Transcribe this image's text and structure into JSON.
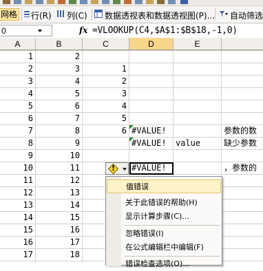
{
  "toolbar": {
    "item1_label": "网格",
    "item2_label": "行(R)",
    "item3_label": "列(C)",
    "item4_label": "数据透视表和数据透视图(P)...",
    "item5_label": "自动筛选"
  },
  "formula_bar": {
    "name_box": "0",
    "fx_label": "fx",
    "formula": "=VLOOKUP(C4,$A$1:$B$18,-1,0)"
  },
  "columns": [
    "A",
    "B",
    "C",
    "D",
    "E"
  ],
  "rows": [
    {
      "a": "1",
      "b": "2"
    },
    {
      "a": "2",
      "b": "3",
      "c": "1"
    },
    {
      "a": "3",
      "b": "4",
      "c": "2"
    },
    {
      "a": "4",
      "b": "5",
      "c": "3"
    },
    {
      "a": "5",
      "b": "6",
      "c": "4"
    },
    {
      "a": "6",
      "b": "7",
      "c": "5"
    },
    {
      "a": "7",
      "b": "8",
      "c": "6",
      "d": "#VALUE!",
      "f": "参数的数"
    },
    {
      "a": "8",
      "b": "9",
      "d": "#VALUE!",
      "e": "value",
      "f": "缺少参数"
    },
    {
      "a": "9",
      "b": "10"
    },
    {
      "a": "10",
      "b": "11",
      "d": "#VALUE!",
      "f": "，参数的"
    },
    {
      "a": "11",
      "b": "12"
    },
    {
      "a": "12",
      "b": "13"
    },
    {
      "a": "13",
      "b": "14"
    },
    {
      "a": "14",
      "b": "15"
    },
    {
      "a": "15",
      "b": "16"
    },
    {
      "a": "16",
      "b": "17"
    },
    {
      "a": "17",
      "b": "18"
    }
  ],
  "error_menu": {
    "items": [
      "值错误",
      "关于此错误的帮助(H)",
      "显示计算步骤(C)...",
      "忽略错误(I)",
      "在公式编辑栏中编辑(F)",
      "错误检查选项(O)..."
    ]
  },
  "colors": {
    "selected_header": "#f8d68a",
    "error_indicator": "#1e8a2a",
    "menu_highlight": "#fdf2c8"
  }
}
